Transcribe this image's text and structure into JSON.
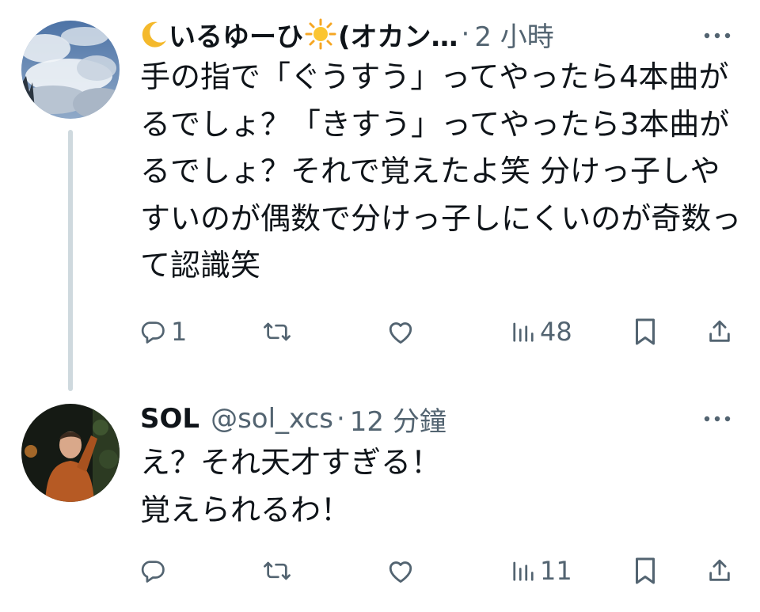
{
  "tweets": [
    {
      "display_name": "いるゆーひ",
      "display_name_suffix": "(オカン…",
      "name_emojis": [
        "crescent-moon-emoji",
        "sun-emoji"
      ],
      "time": "2 小時",
      "avatar": "sky-clouds-photo",
      "text": "手の指で「ぐうすう」ってやったら4本曲がるでしょ？「きすう」ってやったら3本曲がるでしょ？それで覚えたよ笑 分けっ子しやすいのが偶数で分けっ子しにくいのが奇数って認識笑",
      "actions": {
        "reply_count": "1",
        "retweet_count": "",
        "like_count": "",
        "views_count": "48"
      }
    },
    {
      "display_name": "SOL",
      "handle": "@sol_xcs",
      "time": "12 分鐘",
      "avatar": "person-orange-sweater-photo",
      "text": "え？それ天才すぎる！\n覚えられるわ！",
      "actions": {
        "reply_count": "",
        "retweet_count": "",
        "like_count": "",
        "views_count": "11"
      }
    }
  ],
  "icons": {
    "reply": "reply-icon",
    "retweet": "retweet-icon",
    "like": "heart-icon",
    "views": "views-icon",
    "bookmark": "bookmark-icon",
    "share": "share-icon",
    "more": "more-icon"
  },
  "colors": {
    "text_primary": "#0f1419",
    "text_secondary": "#536471",
    "thread_line": "#cfd9de"
  },
  "separator": "·"
}
